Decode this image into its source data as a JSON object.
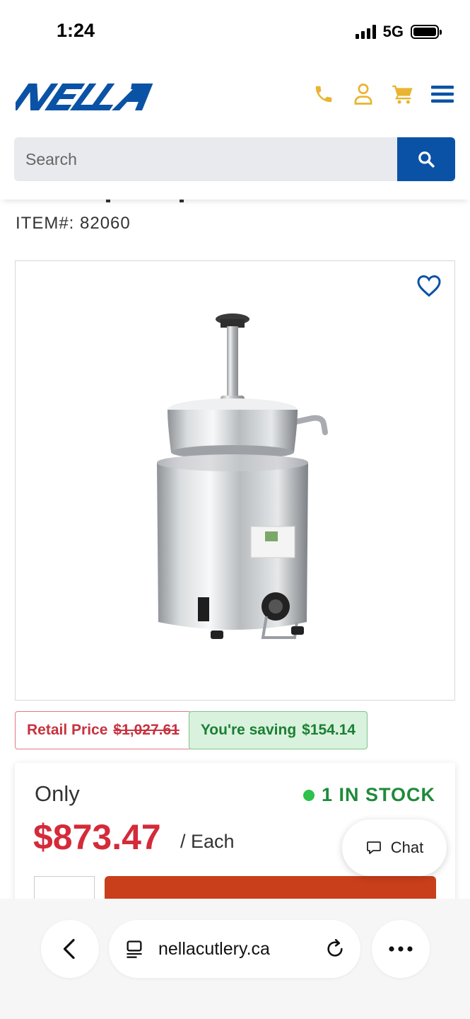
{
  "status": {
    "time": "1:24",
    "network": "5G"
  },
  "header": {
    "logo_text": "NELLA",
    "icons": [
      "phone-icon",
      "user-icon",
      "cart-icon",
      "menu-icon"
    ],
    "brand_blue": "#0a52a5",
    "icon_gold": "#e9b430"
  },
  "search": {
    "placeholder": "Search"
  },
  "product": {
    "item_number_label": "ITEM#: 82060",
    "retail_label": "Retail Price",
    "retail_price": "$1,027.61",
    "saving_label": "You're saving",
    "saving_amount": "$154.14",
    "only_label": "Only",
    "price": "$873.47",
    "unit": "/ Each",
    "stock": "1 IN STOCK"
  },
  "chat": {
    "label": "Chat"
  },
  "browser": {
    "url": "nellacutlery.ca"
  }
}
